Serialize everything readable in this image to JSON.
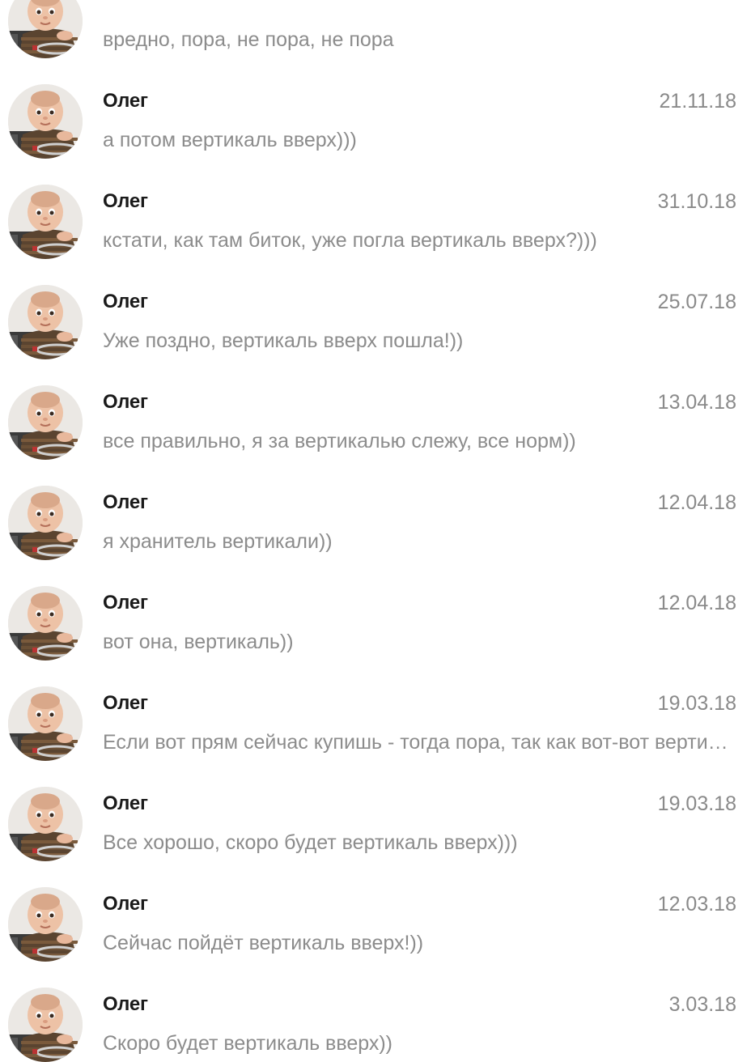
{
  "conversations": [
    {
      "name": "",
      "date": "",
      "preview": "вредно, пора, не пора, не пора"
    },
    {
      "name": "Олег",
      "date": "21.11.18",
      "preview": "а потом вертикаль вверх)))"
    },
    {
      "name": "Олег",
      "date": "31.10.18",
      "preview": "кстати, как там биток, уже погла вертикаль вверх?)))"
    },
    {
      "name": "Олег",
      "date": "25.07.18",
      "preview": "Уже поздно, вертикаль вверх пошла!))"
    },
    {
      "name": "Олег",
      "date": "13.04.18",
      "preview": "все правильно, я за вертикалью слежу, все норм))"
    },
    {
      "name": "Олег",
      "date": "12.04.18",
      "preview": "я хранитель вертикали))"
    },
    {
      "name": "Олег",
      "date": "12.04.18",
      "preview": "вот она, вертикаль))"
    },
    {
      "name": "Олег",
      "date": "19.03.18",
      "preview": "Если вот прям сейчас купишь - тогда пора, так как вот-вот вертикаль вверх"
    },
    {
      "name": "Олег",
      "date": "19.03.18",
      "preview": "Все хорошо, скоро будет вертикаль вверх)))"
    },
    {
      "name": "Олег",
      "date": "12.03.18",
      "preview": "Сейчас пойдёт вертикаль вверх!))"
    },
    {
      "name": "Олег",
      "date": "3.03.18",
      "preview": "Скоро будет вертикаль вверх))"
    }
  ],
  "icons": {
    "avatar": "baby-photo-avatar-icon"
  },
  "colors": {
    "name": "#1a1a1a",
    "preview": "#8c8c8c",
    "date": "#8a8a8a",
    "background": "#ffffff"
  }
}
